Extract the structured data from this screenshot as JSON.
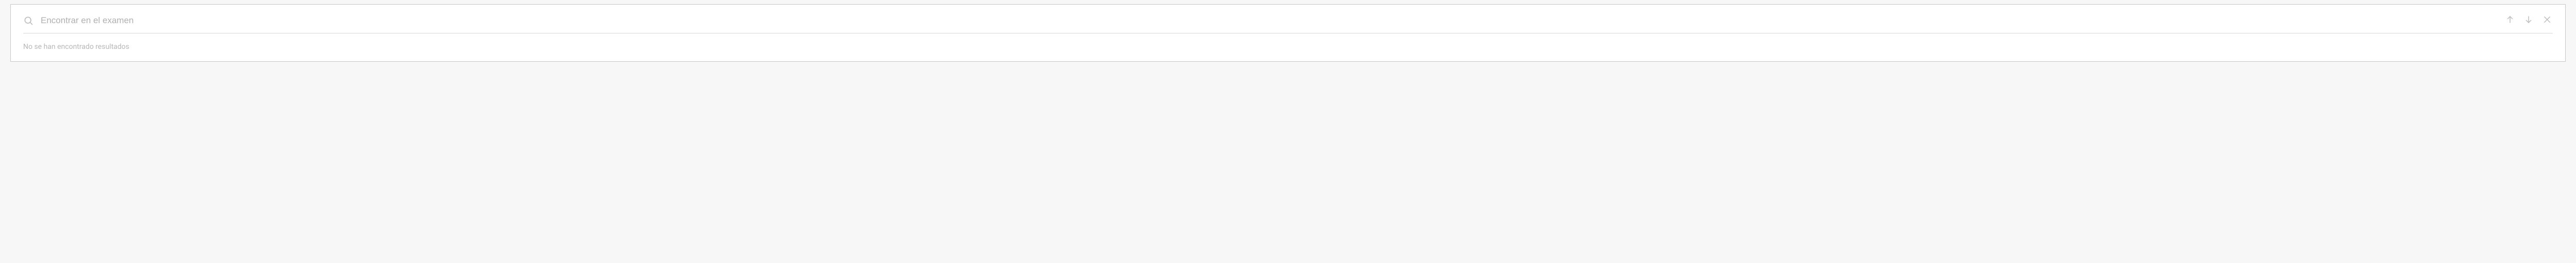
{
  "search": {
    "placeholder": "Encontrar en el examen",
    "value": "",
    "no_results_text": "No se han encontrado resultados"
  }
}
